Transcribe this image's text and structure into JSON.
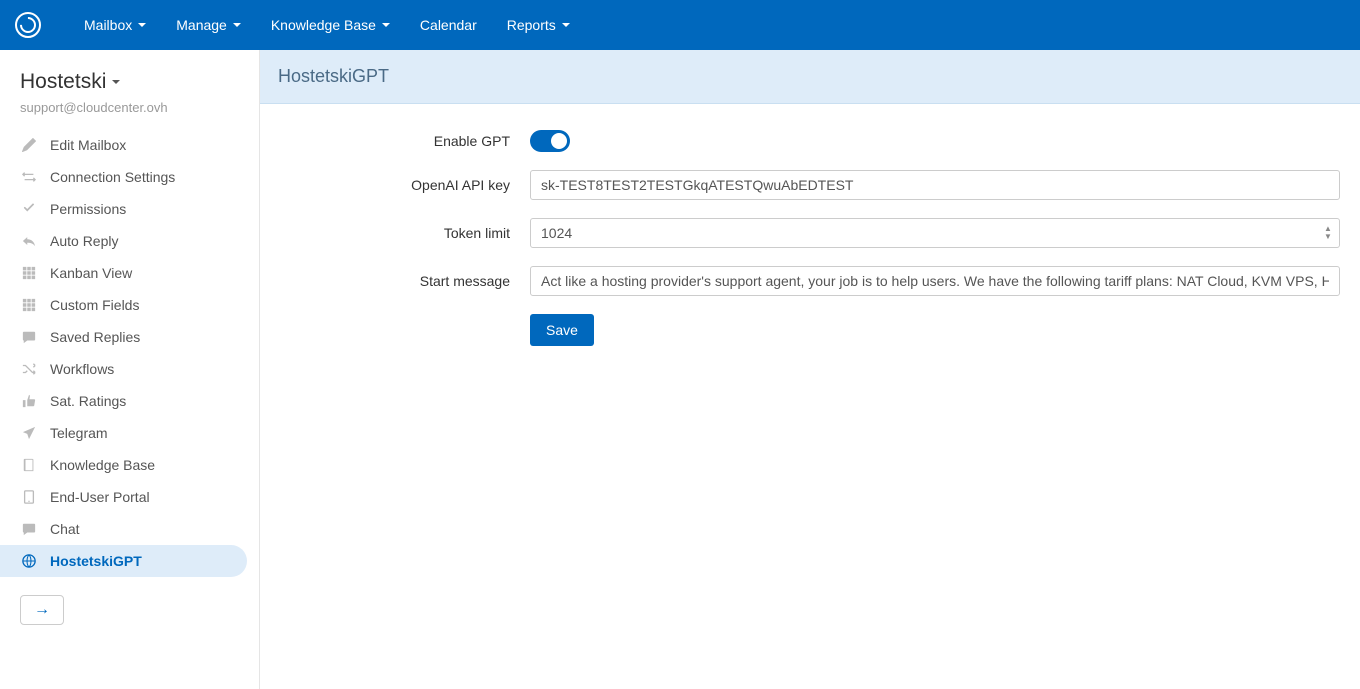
{
  "nav": {
    "items": [
      {
        "label": "Mailbox",
        "caret": true
      },
      {
        "label": "Manage",
        "caret": true
      },
      {
        "label": "Knowledge Base",
        "caret": true
      },
      {
        "label": "Calendar",
        "caret": false
      },
      {
        "label": "Reports",
        "caret": true
      }
    ]
  },
  "sidebar": {
    "title": "Hostetski",
    "email": "support@cloudcenter.ovh",
    "items": [
      {
        "label": "Edit Mailbox",
        "icon": "pencil"
      },
      {
        "label": "Connection Settings",
        "icon": "arrows-h"
      },
      {
        "label": "Permissions",
        "icon": "check"
      },
      {
        "label": "Auto Reply",
        "icon": "reply"
      },
      {
        "label": "Kanban View",
        "icon": "grid"
      },
      {
        "label": "Custom Fields",
        "icon": "grid"
      },
      {
        "label": "Saved Replies",
        "icon": "comment"
      },
      {
        "label": "Workflows",
        "icon": "shuffle"
      },
      {
        "label": "Sat. Ratings",
        "icon": "thumbs-up"
      },
      {
        "label": "Telegram",
        "icon": "paper-plane"
      },
      {
        "label": "Knowledge Base",
        "icon": "book"
      },
      {
        "label": "End-User Portal",
        "icon": "tablet"
      },
      {
        "label": "Chat",
        "icon": "comment"
      },
      {
        "label": "HostetskiGPT",
        "icon": "globe",
        "active": true
      }
    ]
  },
  "page": {
    "title": "HostetskiGPT"
  },
  "form": {
    "enable_gpt_label": "Enable GPT",
    "enable_gpt_value": true,
    "api_key_label": "OpenAI API key",
    "api_key_value": "sk-TEST8TEST2TESTGkqATESTQwuAbEDTEST",
    "token_limit_label": "Token limit",
    "token_limit_value": "1024",
    "start_message_label": "Start message",
    "start_message_value": "Act like a hosting provider's support agent, your job is to help users. We have the following tariff plans: NAT Cloud, KVM VPS, HZ Cloud",
    "save_label": "Save"
  }
}
